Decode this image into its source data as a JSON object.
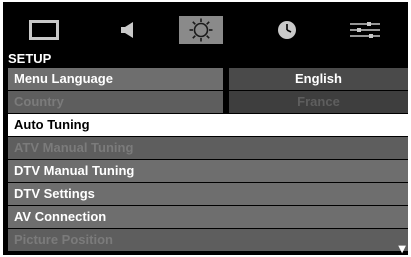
{
  "tabs": [
    {
      "icon": "picture-icon",
      "active": false
    },
    {
      "icon": "speaker-icon",
      "active": false
    },
    {
      "icon": "gear-icon",
      "active": true
    },
    {
      "icon": "clock-icon",
      "active": false
    },
    {
      "icon": "sliders-icon",
      "active": false
    }
  ],
  "menu": {
    "title": "SETUP",
    "items": [
      {
        "label": "Menu Language",
        "value": "English",
        "state": "normal"
      },
      {
        "label": "Country",
        "value": "France",
        "state": "disabled"
      },
      {
        "label": "Auto Tuning",
        "state": "selected"
      },
      {
        "label": "ATV Manual Tuning",
        "state": "disabled"
      },
      {
        "label": "DTV Manual Tuning",
        "state": "normal"
      },
      {
        "label": "DTV Settings",
        "state": "normal"
      },
      {
        "label": "AV Connection",
        "state": "normal"
      },
      {
        "label": "Picture Position",
        "state": "disabled"
      }
    ],
    "scroll_indicator": "▼"
  },
  "colors": {
    "background": "#000000",
    "row_normal": "#6e6e6e",
    "row_selected": "#ffffff",
    "value_bg": "#4a4a4a",
    "disabled_text": "#7b7b7b"
  }
}
